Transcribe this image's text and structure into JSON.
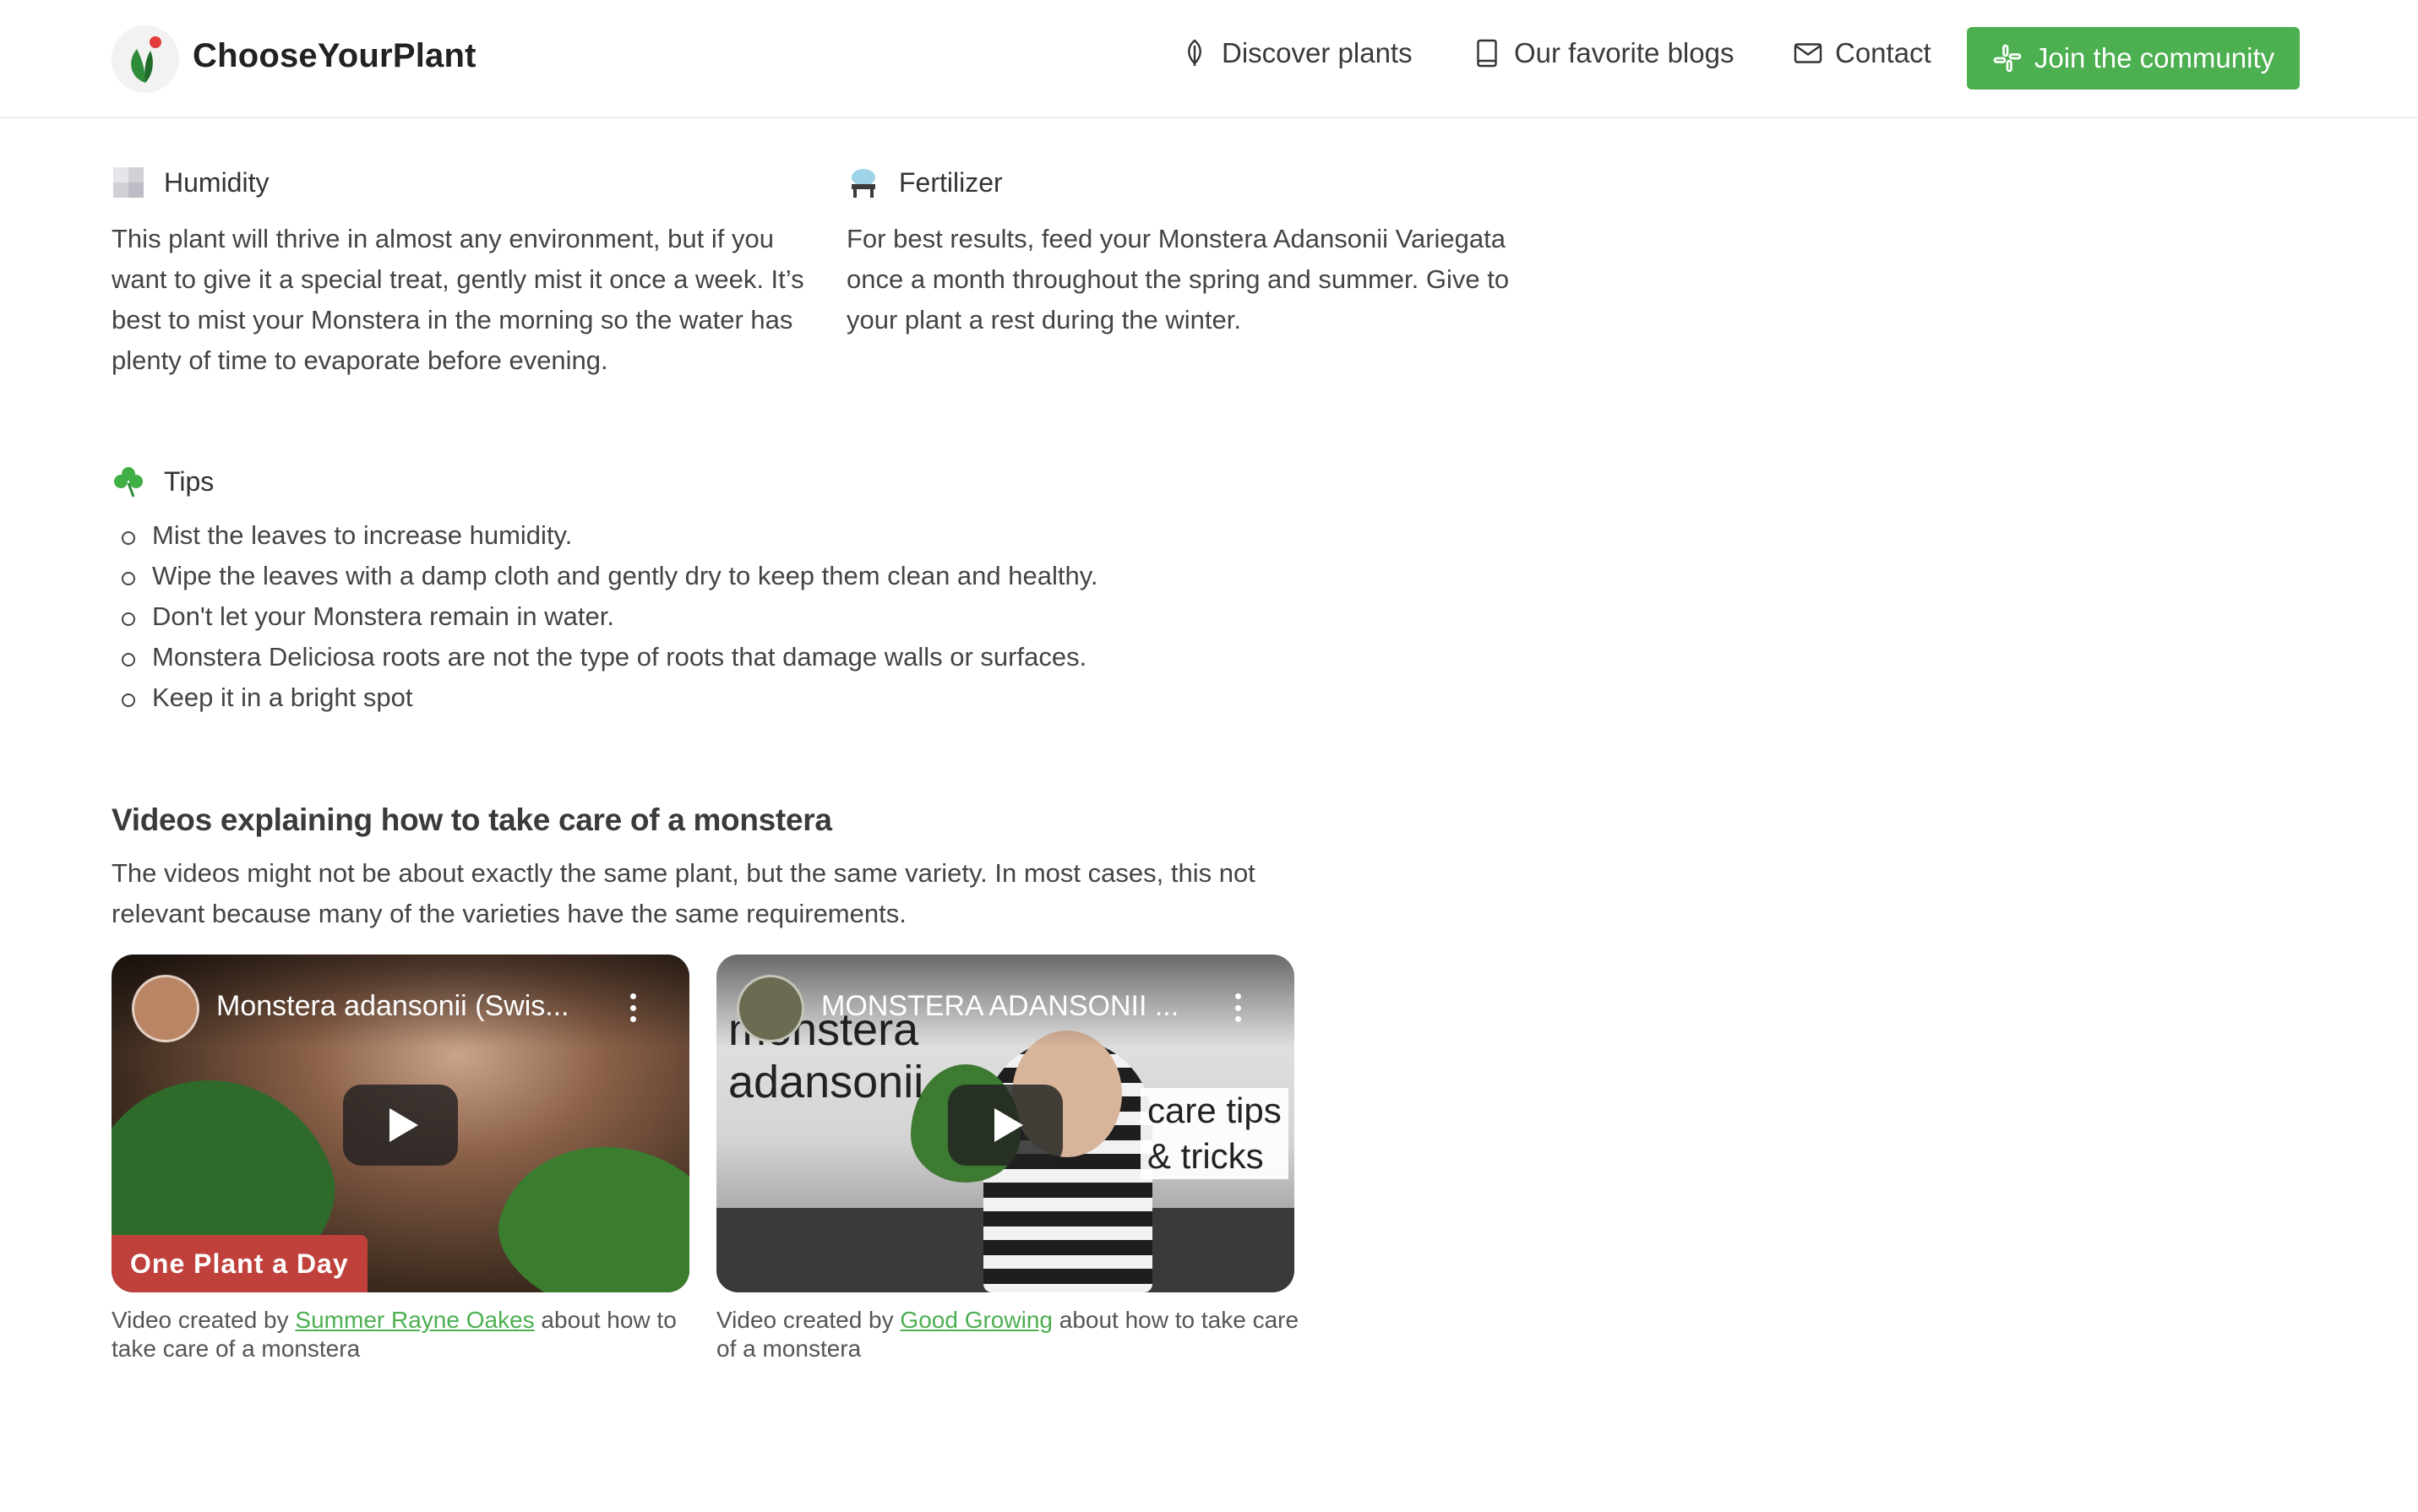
{
  "header": {
    "brand": "ChooseYourPlant",
    "nav": {
      "discover": "Discover plants",
      "blogs": "Our favorite blogs",
      "contact": "Contact"
    },
    "join_button": "Join the community"
  },
  "humidity": {
    "title": "Humidity",
    "text": "This plant will thrive in almost any environment, but if you want to give it a special treat, gently mist it once a week. It’s best to mist your Monstera in the morning so the water has plenty of time to evaporate before evening."
  },
  "fertilizer": {
    "title": "Fertilizer",
    "text": "For best results, feed your Monstera Adansonii Variegata once a month throughout the spring and summer. Give to your plant a rest during the winter."
  },
  "tips": {
    "title": "Tips",
    "items": [
      "Mist the leaves to increase humidity.",
      "Wipe the leaves with a damp cloth and gently dry to keep them clean and healthy.",
      "Don't let your Monstera remain in water.",
      "Monstera Deliciosa roots are not the type of roots that damage walls or surfaces.",
      "Keep it in a bright spot"
    ]
  },
  "videos": {
    "title": "Videos explaining how to take care of a monstera",
    "subtitle": "The videos might not be about exactly the same plant, but the same variety. In most cases, this not relevant because many of the varieties have the same requirements.",
    "items": [
      {
        "title": "Monstera adansonii (Swis...",
        "badge": "One Plant a Day",
        "caption_prefix": "Video created by ",
        "author": "Summer Rayne Oakes",
        "caption_suffix": " about how to take care of a monstera"
      },
      {
        "title": "MONSTERA ADANSONII ...",
        "overlay_left_line1": "monstera",
        "overlay_left_line2": "adansonii",
        "overlay_right_line1": "care tips",
        "overlay_right_line2": "& tricks",
        "caption_prefix": "Video created by ",
        "author": "Good Growing",
        "caption_suffix": " about how to take care of a monstera"
      }
    ]
  },
  "colors": {
    "accent_green": "#4caf50",
    "badge_red": "#c0403c",
    "text": "#444444"
  },
  "icons": {
    "logo": "plant-logo",
    "discover": "leaf-icon",
    "blogs": "book-icon",
    "contact": "mail-icon",
    "join": "slack-icon",
    "humidity": "humidity-icon",
    "fertilizer": "fertilizer-icon",
    "tips": "clover-icon"
  }
}
